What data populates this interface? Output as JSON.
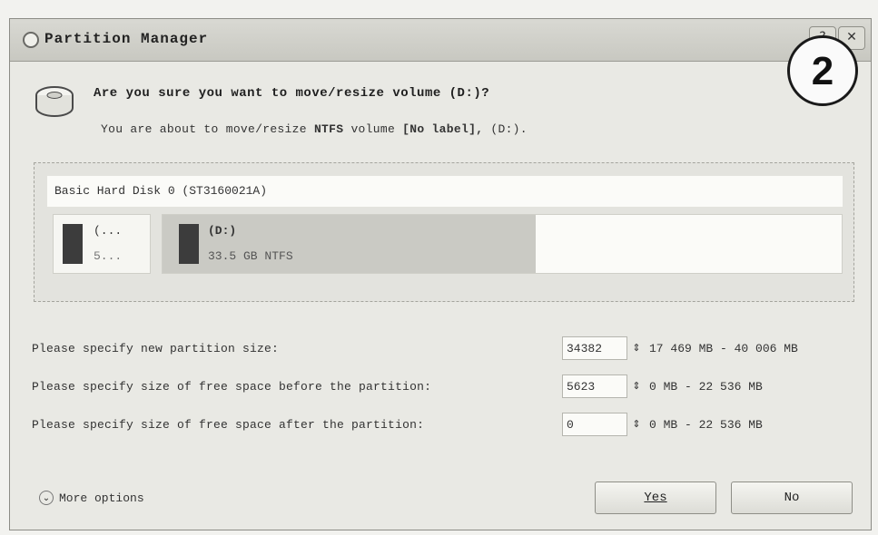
{
  "window": {
    "title": "Partition Manager",
    "help_glyph": "?",
    "close_glyph": "✕"
  },
  "step_badge": "2",
  "question": "Are you sure you want to move/resize volume (D:)?",
  "subtext": {
    "prefix": "You are about to move/resize ",
    "fs": "NTFS",
    "middle": " volume ",
    "label": "[No label],",
    "suffix": " (D:)."
  },
  "disk": {
    "header": "Basic Hard Disk 0 (ST3160021A)",
    "small_partition": {
      "line1": "(...",
      "line2": "5..."
    },
    "main_partition": {
      "line1": "(D:)",
      "line2": "33.5 GB NTFS",
      "used_fraction": 0.55
    }
  },
  "fields": [
    {
      "label": "Please specify new partition size:",
      "value": "34382",
      "range": "17 469 MB - 40 006 MB"
    },
    {
      "label": "Please specify size of free space before the partition:",
      "value": "5623",
      "range": "0 MB - 22 536 MB"
    },
    {
      "label": "Please specify size of free space after the partition:",
      "value": "0",
      "range": "0 MB - 22 536 MB"
    }
  ],
  "more_options": "More options",
  "buttons": {
    "yes": "Yes",
    "no": "No"
  },
  "icons": {
    "app": "partition-manager-icon",
    "disk": "hard-disk-icon",
    "more": "chevron-down-circle-icon",
    "spin": "spinner-arrows-icon"
  }
}
